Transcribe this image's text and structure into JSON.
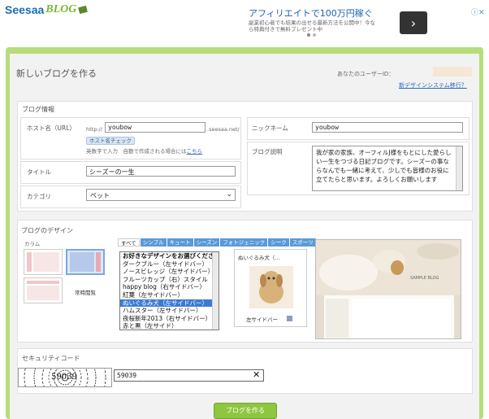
{
  "header": {
    "logo_part1": "Seesaa",
    "logo_part2": "BLOG"
  },
  "ad": {
    "title": "アフィリエイトで100万円稼ぐ",
    "body": "副業初心者でも結果の出せる最新方法を公開中！今なら特典付きで無料プレゼント中",
    "next": "›",
    "close": "ⓘ✕"
  },
  "page": {
    "title": "新しいブログを作る",
    "userid_label": "あなたのユーザーID：",
    "new_design_link": "新デザインシステム移行？"
  },
  "blog_info": {
    "section": "ブログ情報",
    "host_label": "ホスト名（URL）",
    "host_prefix": "http://",
    "host_value": "youbow",
    "host_suffix": ".seesaa.net/",
    "check_button": "ホスト名チェック",
    "host_note": "英数字で入力　自動で作成される場合には",
    "host_note_link": "こちら",
    "nickname_label": "ニックネーム",
    "nickname_value": "youbow",
    "title_label": "タイトル",
    "title_value": "シーズーの一生",
    "description_label": "ブログ説明",
    "description_value": "我が家の家族、オーフィルJ様をもとにした愛らしい一生をつづる日記ブログです。シーズーの事ならなんでも一緒に考えて、少しでも皆様のお役に立てたらと思います。よろしくお願いします",
    "category_label": "カテゴリ",
    "category_value": "ペット"
  },
  "design": {
    "section": "ブログのデザイン",
    "column_label": "カラム",
    "layout_option": "常時閲覧",
    "tabs": [
      "すべて",
      "シンプル",
      "キュート",
      "シーズン",
      "フォトジェニック",
      "シーク",
      "スポーツ"
    ],
    "list_header": "お好きなデザインをお選びください",
    "list_items": [
      "ダークブルー（左サイドバー）",
      "ノースビレッジ（左サイドバー）",
      "フルーツカップ（右）スタイル",
      "happy blog（右サイドバー）",
      "紅葉（左サイドバー）",
      "ぬいぐるみ犬（左サイドバー）",
      "ハムスター（左サイドバー）",
      "夜桜新年2013（右サイドバー）",
      "赤と黒（左サイド）"
    ],
    "selected_index": 5,
    "preview_name": "ぬいぐるみ犬（…",
    "preview_caption": "左サイドバー",
    "big_preview_caption": "SAMPLE BLOG"
  },
  "captcha": {
    "section": "セキュリティコード",
    "image_text": "59039",
    "value": "59039",
    "clear": "✕"
  },
  "submit": {
    "label": "ブログを作る"
  },
  "colors": {
    "frame": "#b7dc7a",
    "selected": "#3c7bd4",
    "link": "#2a6ab8"
  }
}
